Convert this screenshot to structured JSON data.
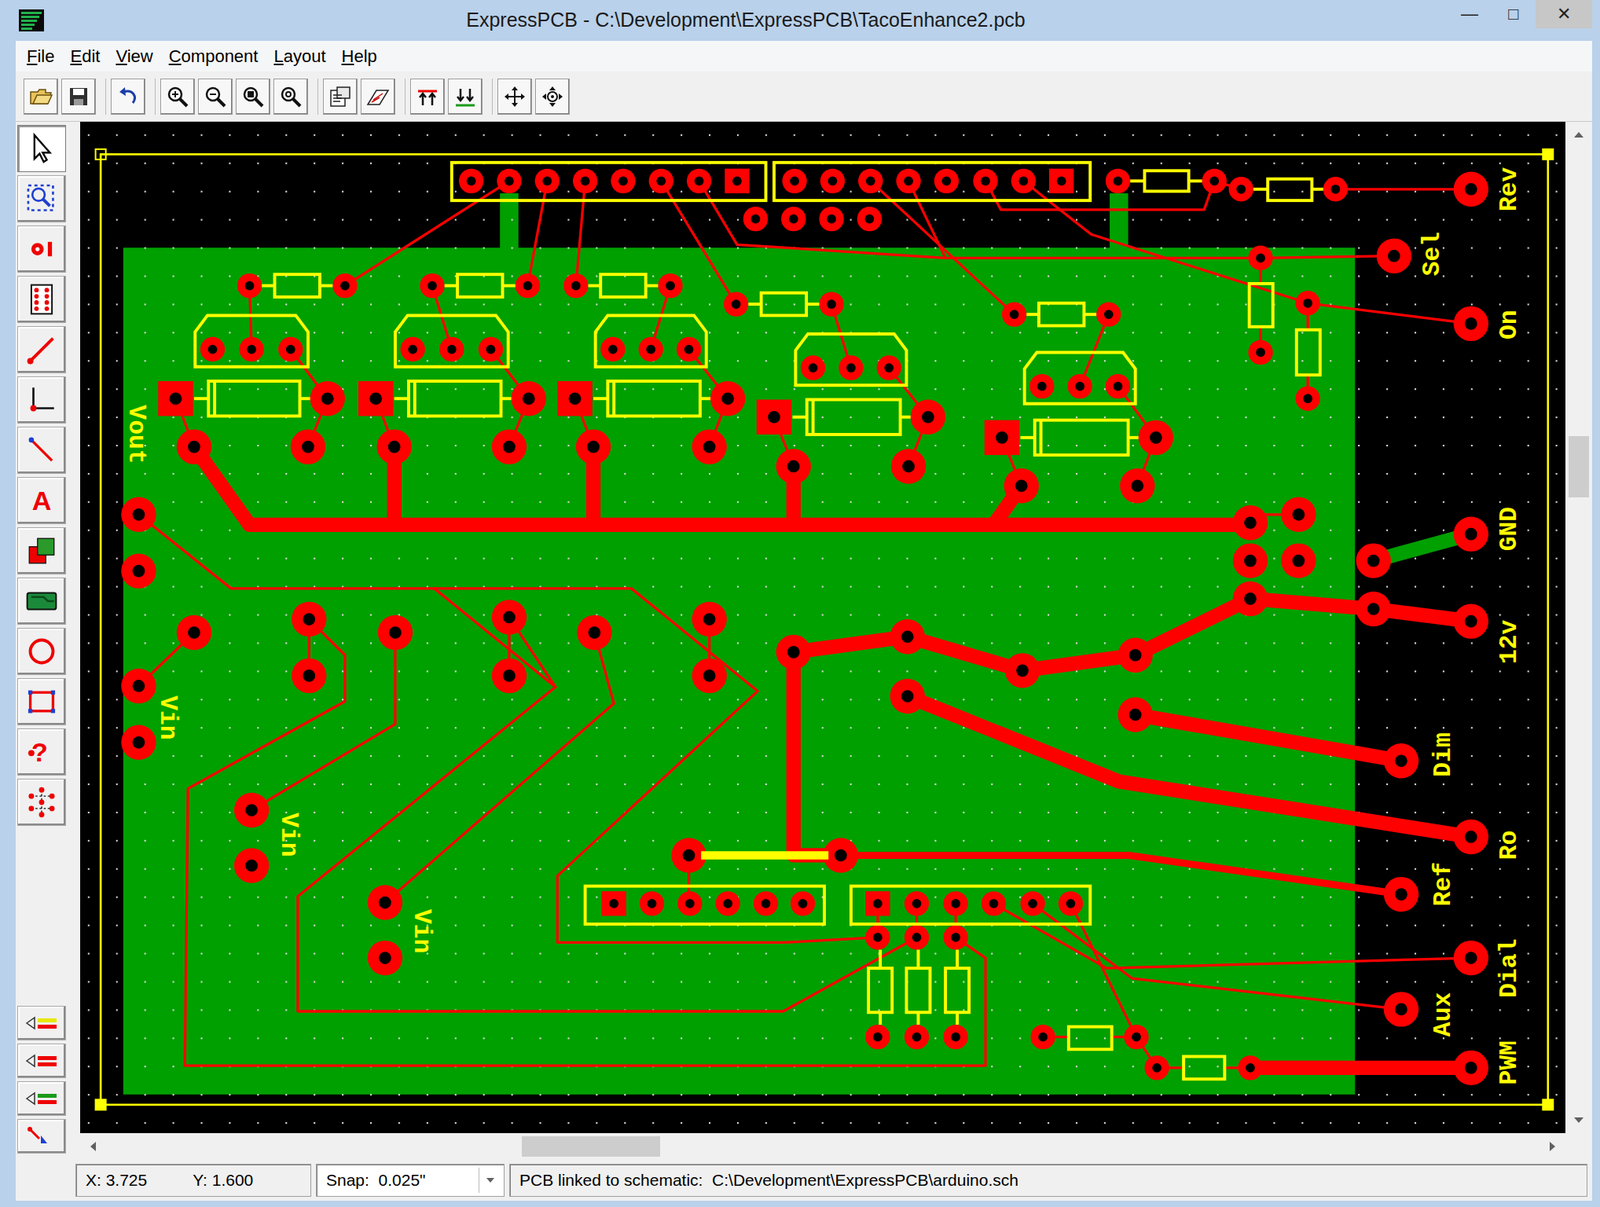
{
  "window": {
    "title": "ExpressPCB - C:\\Development\\ExpressPCB\\TacoEnhance2.pcb",
    "controls": [
      "—",
      "□",
      "✕"
    ]
  },
  "menu": {
    "items": [
      "File",
      "Edit",
      "View",
      "Component",
      "Layout",
      "Help"
    ]
  },
  "palette": {
    "tools": [
      {
        "selected": true
      },
      {
        "selected": false
      },
      {
        "selected": false
      },
      {
        "selected": false
      },
      {
        "selected": false
      },
      {
        "selected": false
      },
      {
        "selected": false
      },
      {
        "selected": false,
        "glyph": "A"
      },
      {
        "selected": false
      },
      {
        "selected": false
      },
      {
        "selected": false
      },
      {
        "selected": false
      },
      {
        "selected": false,
        "glyph": "?"
      },
      {
        "selected": false
      }
    ],
    "layers": [
      {
        "selected": false
      },
      {
        "selected": false
      },
      {
        "selected": false
      },
      {
        "selected": false
      }
    ]
  },
  "pcb": {
    "labels": [
      {
        "text": "Rev"
      },
      {
        "text": "Sel"
      },
      {
        "text": "On"
      },
      {
        "text": "GND"
      },
      {
        "text": "12v"
      },
      {
        "text": "Dim"
      },
      {
        "text": "Ro"
      },
      {
        "text": "Ref"
      },
      {
        "text": "Dial"
      },
      {
        "text": "Aux"
      },
      {
        "text": "PWM"
      },
      {
        "text": "Vout"
      },
      {
        "text": "Vin"
      },
      {
        "text": "Vin"
      },
      {
        "text": "Vin"
      }
    ]
  },
  "status_bar": {
    "x": "X: 3.725",
    "y": "Y: 1.600",
    "snap": "Snap:  0.025\"",
    "message": "PCB linked to schematic:  C:\\Development\\ExpressPCB\\arduino.sch"
  }
}
